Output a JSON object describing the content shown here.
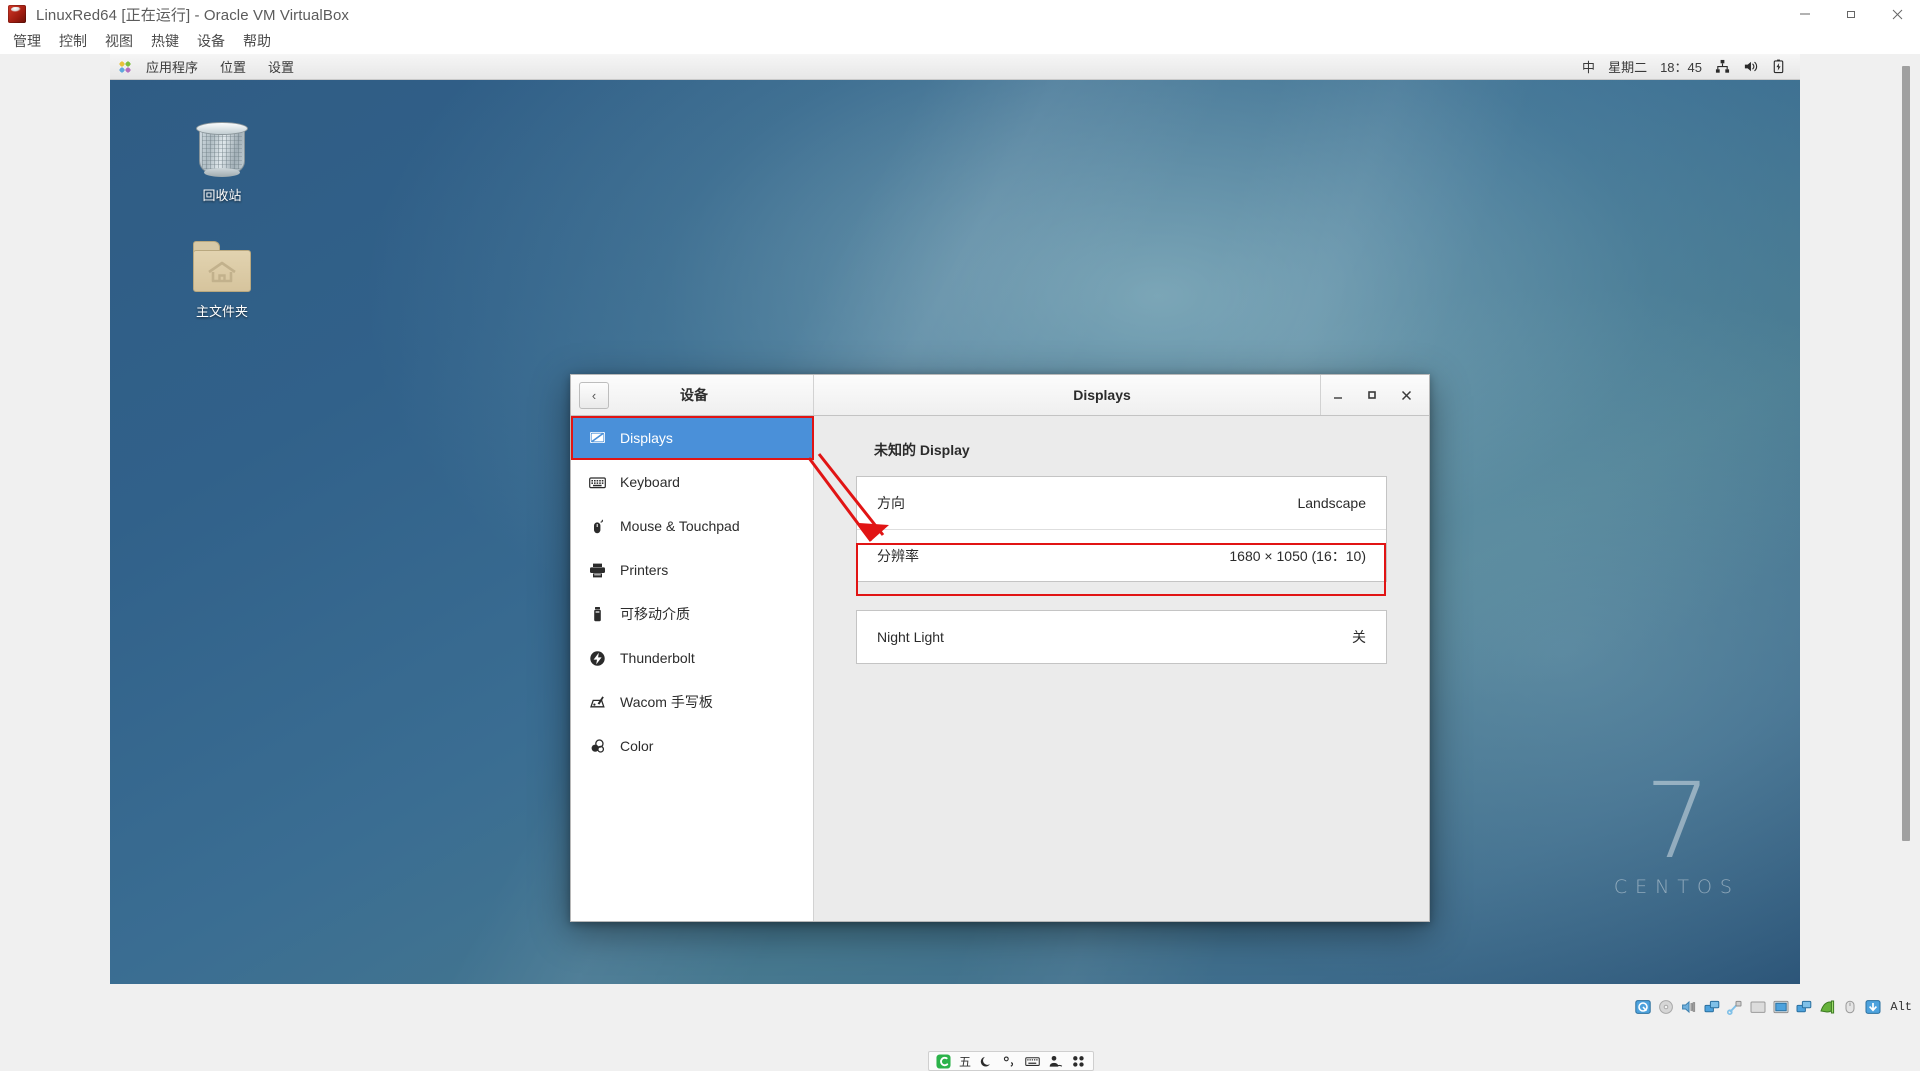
{
  "vbox": {
    "title": "LinuxRed64 [正在运行] - Oracle VM VirtualBox",
    "app_icon": "virtualbox-icon",
    "window_controls": {
      "minimize": "—",
      "restore": "❐",
      "close": "✕"
    },
    "menus": [
      "管理",
      "控制",
      "视图",
      "热键",
      "设备",
      "帮助"
    ],
    "statusbar": {
      "icons": [
        "hard-disk-icon",
        "optical-disk-icon",
        "audio-icon",
        "network-icon",
        "usb-icon",
        "shared-folder-icon",
        "display-icon",
        "recording-icon",
        "vm-capture-icon",
        "mouse-icon",
        "keyboard-indicator-icon"
      ],
      "host_key": "Alt"
    }
  },
  "gnome_panel": {
    "apps_icon": "applications-icon",
    "left_menus": [
      "应用程序",
      "位置",
      "设置"
    ],
    "input_method": "中",
    "weekday": "星期二",
    "time": "18：45",
    "tray_icons": [
      "network-icon",
      "volume-icon",
      "battery-icon"
    ]
  },
  "desktop": {
    "icons": [
      {
        "name": "trash-icon",
        "label": "回收站"
      },
      {
        "name": "home-folder-icon",
        "label": "主文件夹"
      }
    ],
    "watermark": {
      "version": "7",
      "name": "CENTOS"
    }
  },
  "settings": {
    "back_button": "‹",
    "left_title": "设备",
    "right_title": "Displays",
    "window_controls": {
      "minimize": "_",
      "maximize": "◻",
      "close": "✕"
    },
    "sidebar": [
      {
        "label": "Displays",
        "icon": "display-icon",
        "active": true
      },
      {
        "label": "Keyboard",
        "icon": "keyboard-icon",
        "active": false
      },
      {
        "label": "Mouse & Touchpad",
        "icon": "mouse-icon",
        "active": false
      },
      {
        "label": "Printers",
        "icon": "printer-icon",
        "active": false
      },
      {
        "label": "可移动介质",
        "icon": "usb-drive-icon",
        "active": false
      },
      {
        "label": "Thunderbolt",
        "icon": "thunderbolt-icon",
        "active": false
      },
      {
        "label": "Wacom 手写板",
        "icon": "wacom-tablet-icon",
        "active": false
      },
      {
        "label": "Color",
        "icon": "color-icon",
        "active": false
      }
    ],
    "display_heading": "未知的  Display",
    "rows": [
      {
        "label": "方向",
        "value": "Landscape"
      },
      {
        "label": "分辨率",
        "value": "1680 × 1050 (16：10)"
      }
    ],
    "night_light": {
      "label": "Night Light",
      "value": "关"
    }
  },
  "annotations": {
    "highlight_color": "#e11414",
    "arrow": "points from Displays sidebar item to the 分辨率 row"
  },
  "sogou": {
    "logo": "sogou-icon",
    "items": [
      "五",
      "moon-icon",
      "punctuation-icon",
      "keyboard-icon",
      "user-icon",
      "menu-grid-icon"
    ]
  }
}
